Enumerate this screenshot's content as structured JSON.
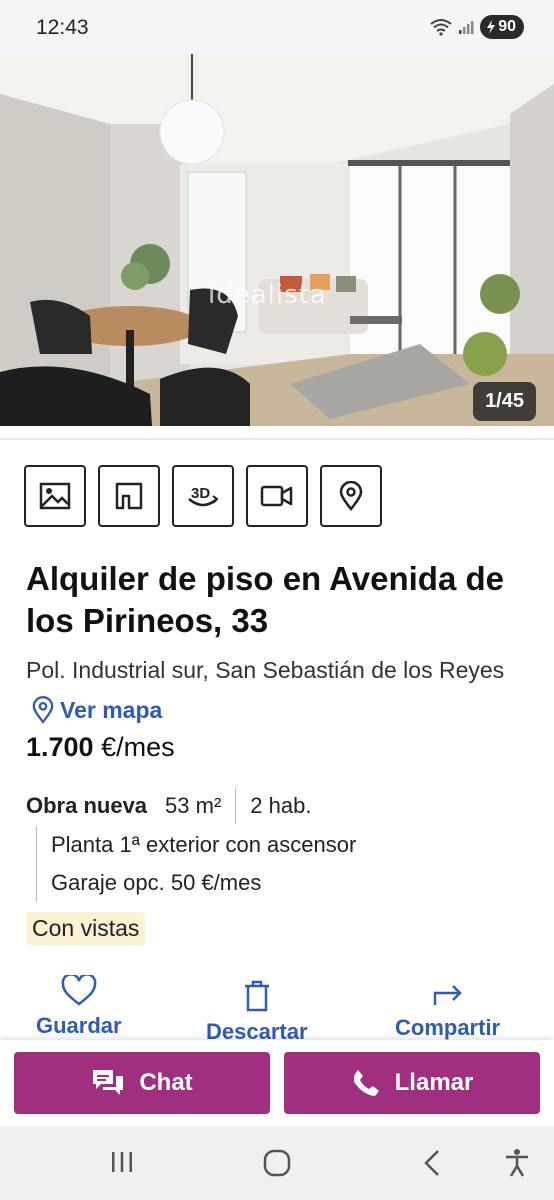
{
  "status": {
    "time": "12:43",
    "battery": "90"
  },
  "photo": {
    "watermark": "idealista",
    "counter": "1/45"
  },
  "media_buttons": [
    "image-icon",
    "floorplan-icon",
    "3d-tour-icon",
    "video-icon",
    "map-pin-icon"
  ],
  "listing": {
    "title": "Alquiler de piso en Avenida de los Pirineos, 33",
    "address": "Pol. Industrial sur, San Sebastián de los Reyes",
    "map_link": "Ver mapa",
    "price_amount": "1.700",
    "price_unit": " €/mes",
    "condition": "Obra nueva",
    "area": "53 m²",
    "rooms": "2 hab.",
    "floor": "Planta 1ª exterior con ascensor",
    "garage": "Garaje opc. 50 €/mes",
    "badge": "Con vistas"
  },
  "actions": {
    "save": "Guardar",
    "discard": "Descartar",
    "share": "Compartir"
  },
  "cta": {
    "chat": "Chat",
    "call": "Llamar"
  },
  "colors": {
    "brand": "#a0307f",
    "link": "#2e5bb8",
    "badge_bg": "#fbf2d3"
  }
}
